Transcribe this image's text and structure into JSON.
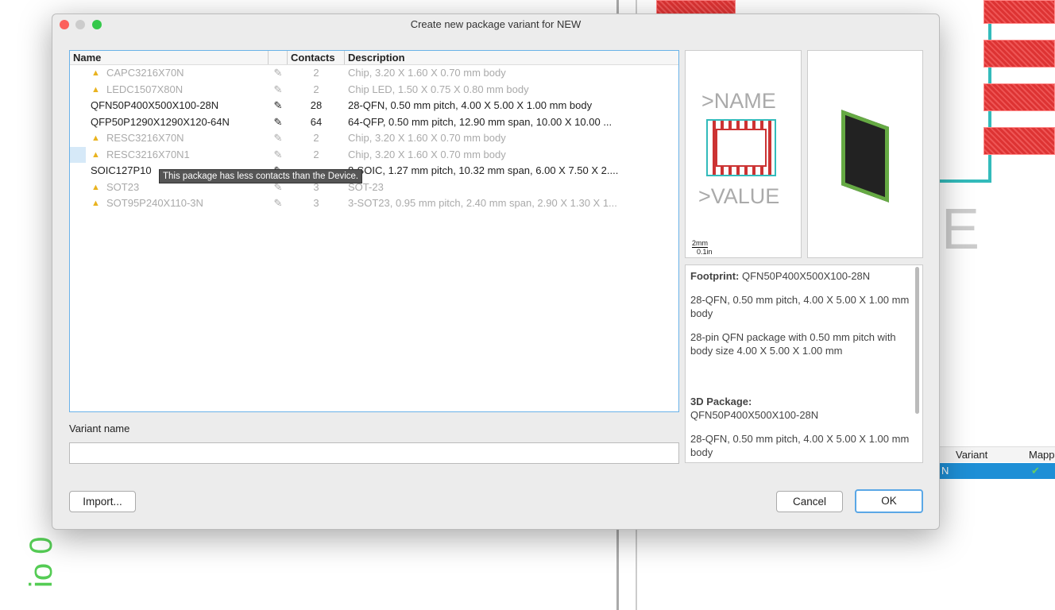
{
  "dialog": {
    "title": "Create new package variant for NEW"
  },
  "table": {
    "headers": {
      "name": "Name",
      "contacts": "Contacts",
      "description": "Description"
    },
    "rows": [
      {
        "name": "CAPC3216X70N",
        "contacts": "2",
        "description": "Chip, 3.20 X 1.60 X 0.70 mm body",
        "warning": true
      },
      {
        "name": "LEDC1507X80N",
        "contacts": "2",
        "description": "Chip LED, 1.50 X 0.75 X 0.80 mm body",
        "warning": true
      },
      {
        "name": "QFN50P400X500X100-28N",
        "contacts": "28",
        "description": "28-QFN, 0.50 mm pitch, 4.00 X 5.00 X 1.00 mm body",
        "warning": false
      },
      {
        "name": "QFP50P1290X1290X120-64N",
        "contacts": "64",
        "description": "64-QFP, 0.50 mm pitch, 12.90 mm span, 10.00 X 10.00 ...",
        "warning": false
      },
      {
        "name": "RESC3216X70N",
        "contacts": "2",
        "description": "Chip, 3.20 X 1.60 X 0.70 mm body",
        "warning": true
      },
      {
        "name": "RESC3216X70N1",
        "contacts": "2",
        "description": "Chip, 3.20 X 1.60 X 0.70 mm body",
        "warning": true
      },
      {
        "name": "SOIC127P10",
        "contacts": "",
        "description": "8-SOIC, 1.27 mm pitch, 10.32 mm span, 6.00 X 7.50 X 2....",
        "warning": false
      },
      {
        "name": "SOT23",
        "contacts": "3",
        "description": "SOT-23",
        "warning": true
      },
      {
        "name": "SOT95P240X110-3N",
        "contacts": "3",
        "description": "3-SOT23, 0.95 mm pitch, 2.40 mm span, 2.90 X 1.30 X 1...",
        "warning": true
      }
    ]
  },
  "tooltip": "This package has less contacts than the Device.",
  "variant": {
    "label": "Variant name",
    "value": ""
  },
  "buttons": {
    "import": "Import...",
    "cancel": "Cancel",
    "ok": "OK"
  },
  "preview": {
    "name": ">NAME",
    "value": ">VALUE",
    "scale_mm": "2mm",
    "scale_in": "0.1in"
  },
  "info": {
    "footprint_label": "Footprint:",
    "footprint": "QFN50P400X500X100-28N",
    "fp_desc": "28-QFN, 0.50 mm pitch, 4.00 X 5.00 X 1.00 mm body",
    "fp_long": "28-pin QFN package with 0.50 mm pitch with body size 4.00 X 5.00 X 1.00 mm",
    "pkg3d_label": "3D Package:",
    "pkg3d": "QFN50P400X500X100-28N",
    "pkg3d_desc": "28-QFN, 0.50 mm pitch, 4.00 X 5.00 X 1.00 mm body"
  },
  "background": {
    "variant_header": "Variant",
    "mapping_header": "Mapp",
    "row_text": "N",
    "big_letter": "E",
    "side_text": "io 0"
  },
  "colors": {
    "accent": "#1e8fd6",
    "warning": "#e9b320",
    "pad": "#d33333"
  }
}
